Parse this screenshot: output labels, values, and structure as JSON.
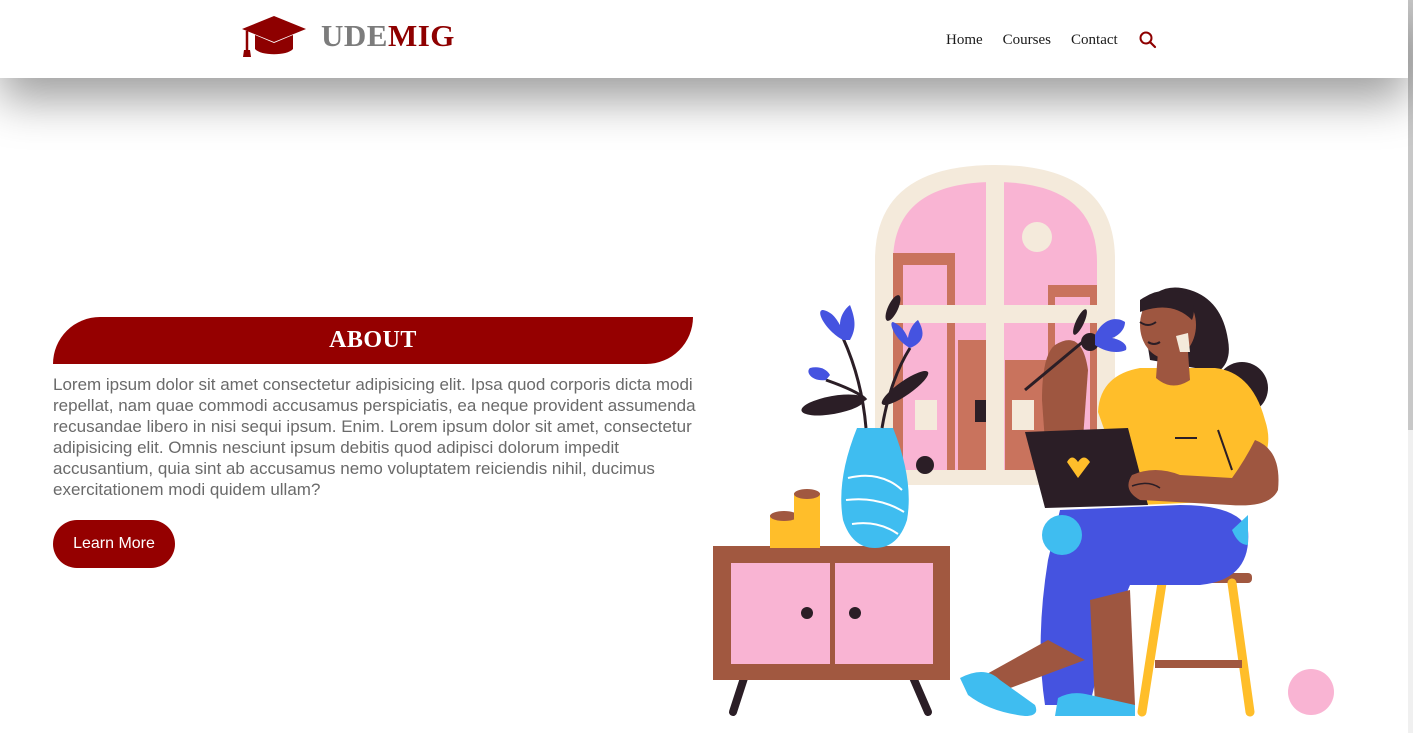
{
  "brand": {
    "name_part1": "UDE",
    "name_part2": "MIG",
    "logo_icon": "graduation-cap-icon"
  },
  "nav": {
    "links": [
      "Home",
      "Courses",
      "Contact"
    ],
    "search_icon": "search-icon"
  },
  "about": {
    "title": "ABOUT",
    "body": "Lorem ipsum dolor sit amet consectetur adipisicing elit. Ipsa quod corporis dicta modi repellat, nam quae commodi accusamus perspiciatis, ea neque provident assumenda recusandae libero in nisi sequi ipsum. Enim. Lorem ipsum dolor sit amet, consectetur adipisicing elit. Omnis nesciunt ipsum debitis quod adipisci dolorum impedit accusantium, quia sint ab accusamus nemo voluptatem reiciendis nihil, ducimus exercitationem modi quidem ullam?",
    "button": "Learn More"
  },
  "colors": {
    "accent": "#950000",
    "brand_gray": "#7c7c7c",
    "body_text": "#6a6a6a"
  }
}
